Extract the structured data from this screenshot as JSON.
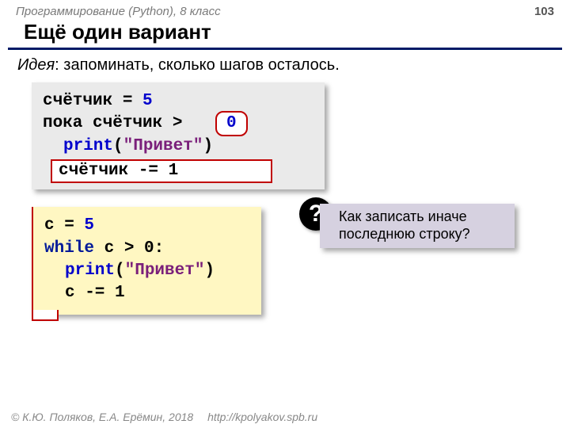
{
  "header": {
    "course": "Программирование (Python), 8 класс",
    "page": "103"
  },
  "title": "Ещё один вариант",
  "idea": {
    "label": "Идея",
    "text": ": запоминать, сколько шагов осталось."
  },
  "pseudo": {
    "l1a": "счётчик = ",
    "l1b": "5",
    "l2a": "пока счётчик > ",
    "zero": "0",
    "l3a": "print",
    "l3b": "(",
    "l3c": "\"Привет\"",
    "l3d": ")",
    "l4": "счётчик -= 1"
  },
  "python": {
    "l1a": "c = ",
    "l1b": "5",
    "l2a": "while",
    "l2b": " c > 0:",
    "l3a": "print",
    "l3b": "(",
    "l3c": "\"Привет\"",
    "l3d": ")",
    "l4": "c -= 1"
  },
  "question": {
    "mark": "?",
    "text": "Как записать иначе последнюю строку?"
  },
  "footer": {
    "copyright": "© К.Ю. Поляков, Е.А. Ерёмин, 2018",
    "url": "http://kpolyakov.spb.ru"
  }
}
